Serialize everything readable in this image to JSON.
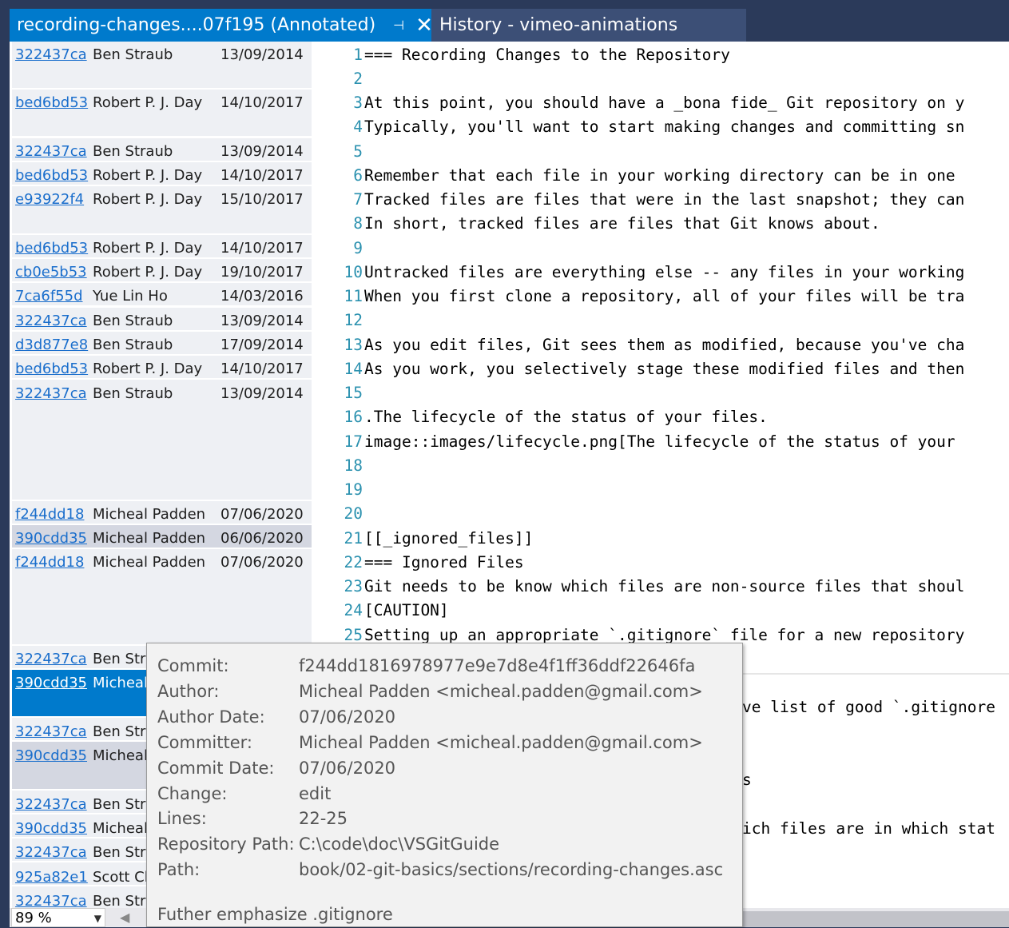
{
  "tabs": {
    "active": {
      "title": "recording-changes....07f195 (Annotated)",
      "pin": "⊣",
      "close": "✕"
    },
    "inactive": {
      "title": "History - vimeo-animations"
    }
  },
  "annotations": [
    {
      "hash": "322437ca",
      "author": "Ben Straub",
      "date": "13/09/2014"
    },
    {
      "hash": "bed6bd53",
      "author": "Robert P. J. Day",
      "date": "14/10/2017"
    },
    {
      "hash": "322437ca",
      "author": "Ben Straub",
      "date": "13/09/2014"
    },
    {
      "hash": "bed6bd53",
      "author": "Robert P. J. Day",
      "date": "14/10/2017"
    },
    {
      "hash": "e93922f4",
      "author": "Robert P. J. Day",
      "date": "15/10/2017"
    },
    {
      "hash": "bed6bd53",
      "author": "Robert P. J. Day",
      "date": "14/10/2017"
    },
    {
      "hash": "cb0e5b53",
      "author": "Robert P. J. Day",
      "date": "19/10/2017"
    },
    {
      "hash": "7ca6f55d",
      "author": "Yue Lin Ho",
      "date": "14/03/2016"
    },
    {
      "hash": "322437ca",
      "author": "Ben Straub",
      "date": "13/09/2014"
    },
    {
      "hash": "d3d877e8",
      "author": "Ben Straub",
      "date": "17/09/2014"
    },
    {
      "hash": "bed6bd53",
      "author": "Robert P. J. Day",
      "date": "14/10/2017"
    },
    {
      "hash": "322437ca",
      "author": "Ben Straub",
      "date": "13/09/2014"
    },
    {
      "hash": "f244dd18",
      "author": "Micheal Padden",
      "date": "07/06/2020"
    },
    {
      "hash": "390cdd35",
      "author": "Micheal Padden",
      "date": "06/06/2020"
    },
    {
      "hash": "f244dd18",
      "author": "Micheal Padden",
      "date": "07/06/2020"
    },
    {
      "hash": "322437ca",
      "author": "Ben Stra",
      "date": ""
    },
    {
      "hash": "390cdd35",
      "author": "Micheal",
      "date": ""
    },
    {
      "hash": "322437ca",
      "author": "Ben Stra",
      "date": ""
    },
    {
      "hash": "390cdd35",
      "author": "Micheal",
      "date": ""
    },
    {
      "hash": "322437ca",
      "author": "Ben Stra",
      "date": ""
    },
    {
      "hash": "390cdd35",
      "author": "Micheal",
      "date": ""
    },
    {
      "hash": "322437ca",
      "author": "Ben Stra",
      "date": ""
    },
    {
      "hash": "925a82e1",
      "author": "Scott Ch",
      "date": ""
    },
    {
      "hash": "322437ca",
      "author": "Ben Stra",
      "date": ""
    }
  ],
  "code": [
    {
      "n": "1",
      "t": "=== Recording Changes to the Repository"
    },
    {
      "n": "2",
      "t": ""
    },
    {
      "n": "3",
      "t": "At this point, you should have a _bona fide_ Git repository on y"
    },
    {
      "n": "4",
      "t": "Typically, you'll want to start making changes and committing sn"
    },
    {
      "n": "5",
      "t": ""
    },
    {
      "n": "6",
      "t": "Remember that each file in your working directory can be in one"
    },
    {
      "n": "7",
      "t": "Tracked files are files that were in the last snapshot; they can"
    },
    {
      "n": "8",
      "t": "In short, tracked files are files that Git knows about."
    },
    {
      "n": "9",
      "t": ""
    },
    {
      "n": "10",
      "t": "Untracked files are everything else -- any files in your working"
    },
    {
      "n": "11",
      "t": "When you first clone a repository, all of your files will be tra"
    },
    {
      "n": "12",
      "t": ""
    },
    {
      "n": "13",
      "t": "As you edit files, Git sees them as modified, because you've cha"
    },
    {
      "n": "14",
      "t": "As you work, you selectively stage these modified files and then"
    },
    {
      "n": "15",
      "t": ""
    },
    {
      "n": "16",
      "t": ".The lifecycle of the status of your files."
    },
    {
      "n": "17",
      "t": "image::images/lifecycle.png[The lifecycle of the status of your"
    },
    {
      "n": "18",
      "t": ""
    },
    {
      "n": "19",
      "t": ""
    },
    {
      "n": "20",
      "t": ""
    },
    {
      "n": "21",
      "t": "[[_ignored_files]]"
    },
    {
      "n": "22",
      "t": "=== Ignored Files"
    },
    {
      "n": "23",
      "t": "Git needs to be know which files are non-source files that shoul"
    },
    {
      "n": "24",
      "t": "[CAUTION]"
    },
    {
      "n": "25",
      "t": "Setting up an appropriate `.gitignore` file for a new repository"
    }
  ],
  "fragments": {
    "f1": "ve list of good `.gitignore",
    "f2": "s",
    "f3": "ich files are in which stat"
  },
  "tooltip": {
    "commit_label": "Commit:",
    "commit": "f244dd1816978977e9e7d8e4f1ff36ddf22646fa",
    "author_label": "Author:",
    "author": "Micheal Padden <micheal.padden@gmail.com>",
    "author_date_label": "Author Date:",
    "author_date": "07/06/2020",
    "committer_label": "Committer:",
    "committer": "Micheal Padden <micheal.padden@gmail.com>",
    "commit_date_label": "Commit Date:",
    "commit_date": "07/06/2020",
    "change_label": "Change:",
    "change": "edit",
    "lines_label": "Lines:",
    "lines": "22-25",
    "repo_label": "Repository Path:",
    "repo": "C:\\code\\doc\\VSGitGuide",
    "path_label": "Path:",
    "path": "book/02-git-basics/sections/recording-changes.asc",
    "message": "Futher emphasize .gitignore"
  },
  "status": {
    "zoom": "89 %",
    "zoom_arrow": "▼",
    "left_arrow": "◀"
  }
}
